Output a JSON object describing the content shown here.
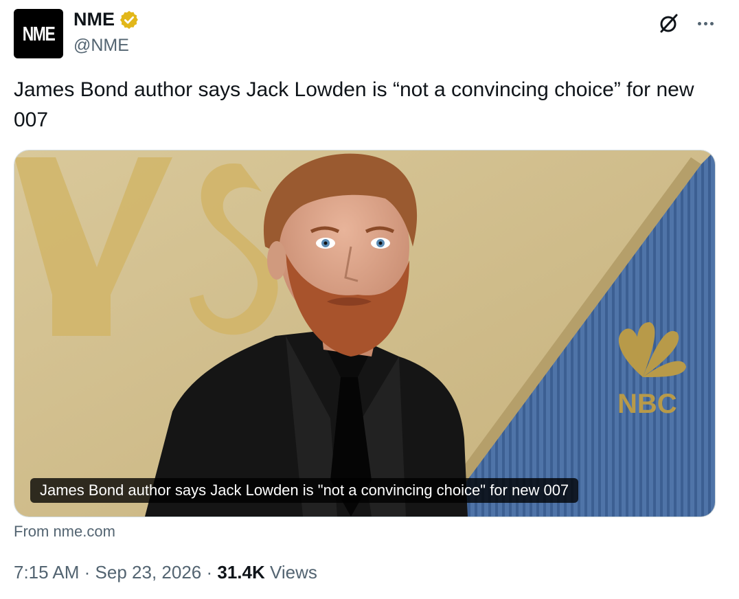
{
  "author": {
    "avatar_text": "NME",
    "display_name": "NME",
    "handle": "@NME",
    "verified_icon": "verified-badge-icon"
  },
  "tweet": {
    "text": "James Bond author says Jack Lowden is “not a convincing choice” for new 007"
  },
  "card": {
    "image_caption": "James Bond author says Jack Lowden is \"not a convincing choice\" for new 007",
    "source": "From nme.com",
    "image_logo_text": "NBC"
  },
  "meta": {
    "time": "7:15 AM",
    "separator": "·",
    "date": "Sep 23, 2026",
    "views_count": "31.4K",
    "views_label": "Views"
  },
  "colors": {
    "verified_gold": "#e2b719",
    "secondary_text": "#536471",
    "primary_text": "#0f1419"
  }
}
